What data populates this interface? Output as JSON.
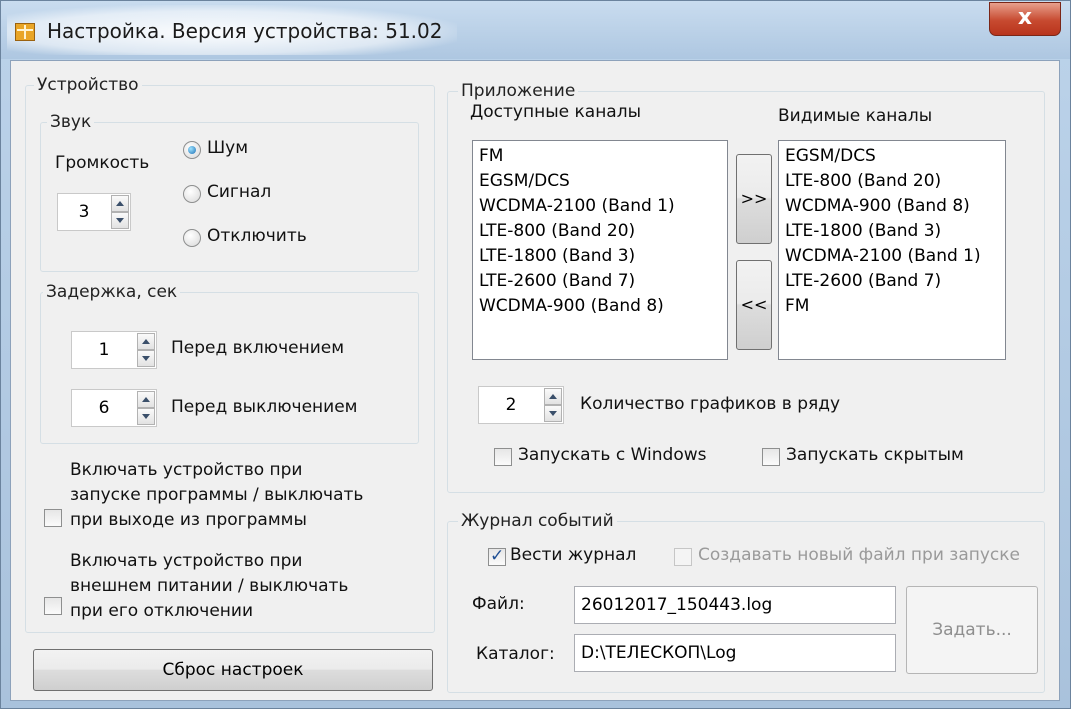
{
  "window": {
    "title": "Настройка. Версия устройства: 51.02",
    "close_glyph": "x"
  },
  "device": {
    "group_label": "Устройство",
    "sound": {
      "group_label": "Звук",
      "volume_label": "Громкость",
      "volume_value": "3",
      "options": [
        "Шум",
        "Сигнал",
        "Отключить"
      ],
      "selected": "Шум"
    },
    "delay": {
      "group_label": "Задержка, сек",
      "before_on_value": "1",
      "before_on_label": "Перед включением",
      "before_off_value": "6",
      "before_off_label": "Перед выключением"
    },
    "checkbox1_lines": [
      "Включать устройство при",
      "запуске программы / выключать",
      "при выходе из программы"
    ],
    "checkbox1_checked": false,
    "checkbox2_lines": [
      "Включать устройство при",
      "внешнем питании / выключать",
      "при его отключении"
    ],
    "checkbox2_checked": false,
    "reset_button": "Сброс настроек"
  },
  "app": {
    "group_label": "Приложение",
    "available_label": "Доступные каналы",
    "available_channels": [
      "FM",
      "EGSM/DCS",
      "WCDMA-2100 (Band 1)",
      "LTE-800 (Band 20)",
      "LTE-1800 (Band 3)",
      "LTE-2600 (Band 7)",
      "WCDMA-900 (Band 8)"
    ],
    "visible_label": "Видимые каналы",
    "visible_channels": [
      "EGSM/DCS",
      "LTE-800 (Band 20)",
      "WCDMA-900 (Band 8)",
      "LTE-1800 (Band 3)",
      "WCDMA-2100 (Band 1)",
      "LTE-2600 (Band 7)",
      "FM"
    ],
    "move_right": ">>",
    "move_left": "<<",
    "charts_per_row_value": "2",
    "charts_per_row_label": "Количество графиков в ряду",
    "run_with_windows_label": "Запускать с Windows",
    "run_with_windows_checked": false,
    "run_hidden_label": "Запускать скрытым",
    "run_hidden_checked": false
  },
  "log": {
    "group_label": "Журнал событий",
    "keep_log_label": "Вести журнал",
    "keep_log_checked": true,
    "new_file_label": "Создавать новый файл при запуске",
    "new_file_checked": false,
    "file_label": "Файл:",
    "file_value": "26012017_150443.log",
    "dir_label": "Каталог:",
    "dir_value": "D:\\ТЕЛЕСКОП\\Log",
    "set_button": "Задать..."
  }
}
